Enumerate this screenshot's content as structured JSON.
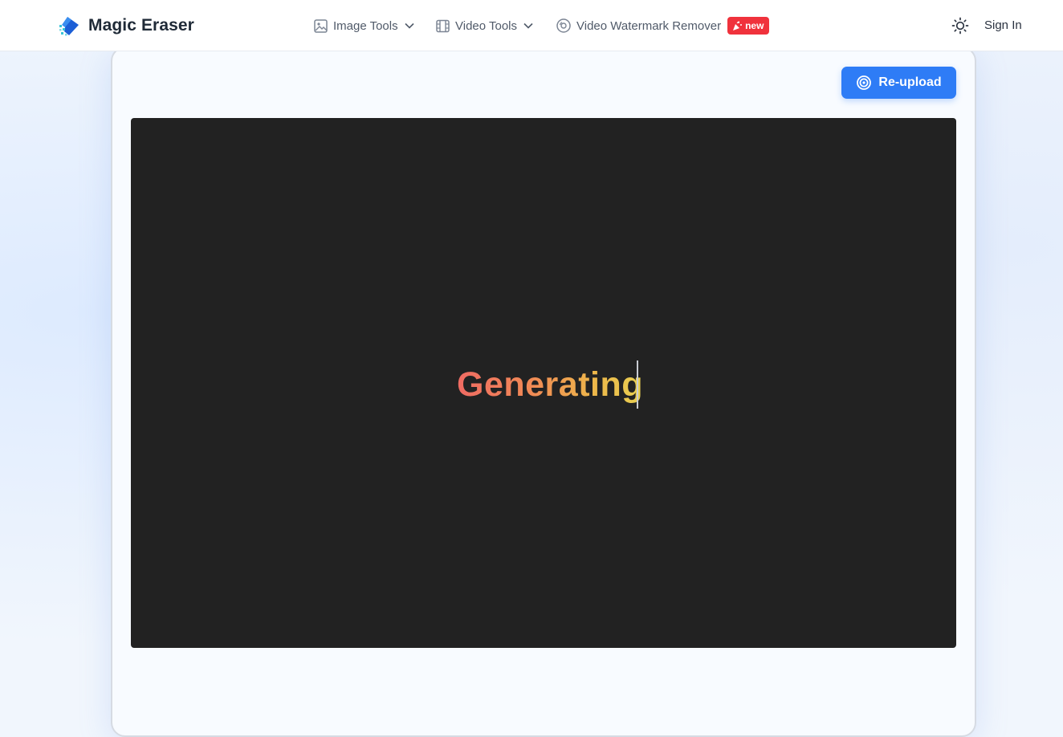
{
  "header": {
    "brand": "Magic Eraser",
    "nav": [
      {
        "label": "Image Tools",
        "icon": "image-icon",
        "has_dropdown": true
      },
      {
        "label": "Video Tools",
        "icon": "film-icon",
        "has_dropdown": true
      },
      {
        "label": "Video Watermark Remover",
        "icon": "video-disc-icon",
        "badge": "new"
      }
    ],
    "sign_in": "Sign In",
    "theme_icon": "sun-icon"
  },
  "main": {
    "reupload_label": "Re-upload",
    "status_text": "Generating"
  },
  "colors": {
    "accent": "#2e7cf6",
    "badge": "#f0323c",
    "stage_bg": "#222222",
    "gradient_start": "#ef6b63",
    "gradient_end": "#e8d052"
  }
}
